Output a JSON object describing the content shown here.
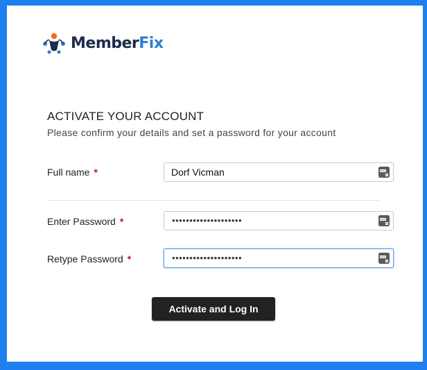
{
  "brand": {
    "part1": "Member",
    "part2": "Fix",
    "colors": {
      "dark": "#1c2b4c",
      "blue": "#2a7fd6",
      "orange": "#f26b1d"
    }
  },
  "page": {
    "title": "ACTIVATE YOUR ACCOUNT",
    "subtitle": "Please confirm your details and set a password for your account"
  },
  "form": {
    "full_name": {
      "label": "Full name",
      "required_mark": "*",
      "value": "Dorf Vicman"
    },
    "password": {
      "label": "Enter Password",
      "required_mark": "*",
      "masked_value": "••••••••••••••••••••"
    },
    "retype_password": {
      "label": "Retype Password",
      "required_mark": "*",
      "masked_value": "••••••••••••••••••••"
    },
    "field_icon": "keychain-autofill-icon"
  },
  "actions": {
    "submit_label": "Activate and Log In"
  },
  "colors": {
    "background": "#1e7ff0",
    "required": "#c8102e",
    "button": "#222222"
  }
}
